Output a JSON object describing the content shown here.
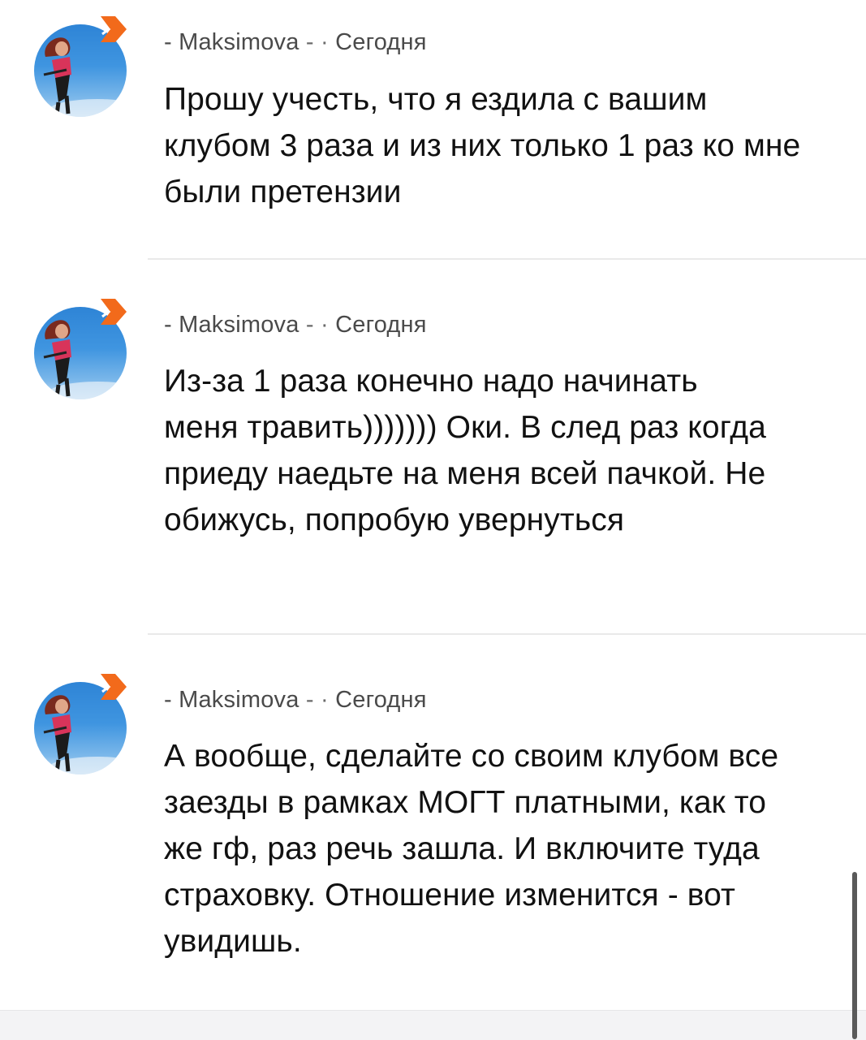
{
  "comments": [
    {
      "author": "Maksimova",
      "time": "Сегодня",
      "text": "Прошу учесть, что я ездила с вашим клубом 3 раза и из них только 1 раз ко мне были претензии"
    },
    {
      "author": "Maksimova",
      "time": "Сегодня",
      "text": "Из-за 1 раза конечно надо начинать меня травить))))))) Оки. В след раз когда приеду наедьте на меня всей пачкой. Не обижусь, попробую увернуться"
    },
    {
      "author": "Maksimova",
      "time": "Сегодня",
      "text": "А вообще, сделайте со своим клубом все заезды в рамках МОГТ платными, как то же гф, раз речь зашла. И включите туда страховку. Отношение изменится - вот увидишь."
    }
  ],
  "meta_prefix": "-",
  "meta_middle": "- ·",
  "colors": {
    "badge": "#f26a1b",
    "sky": "#3f95e0",
    "meta_text": "#4a4a4a"
  },
  "icons": {
    "avatar": "user-photo-avatar",
    "badge": "odnoklassniki-chevron-icon"
  }
}
